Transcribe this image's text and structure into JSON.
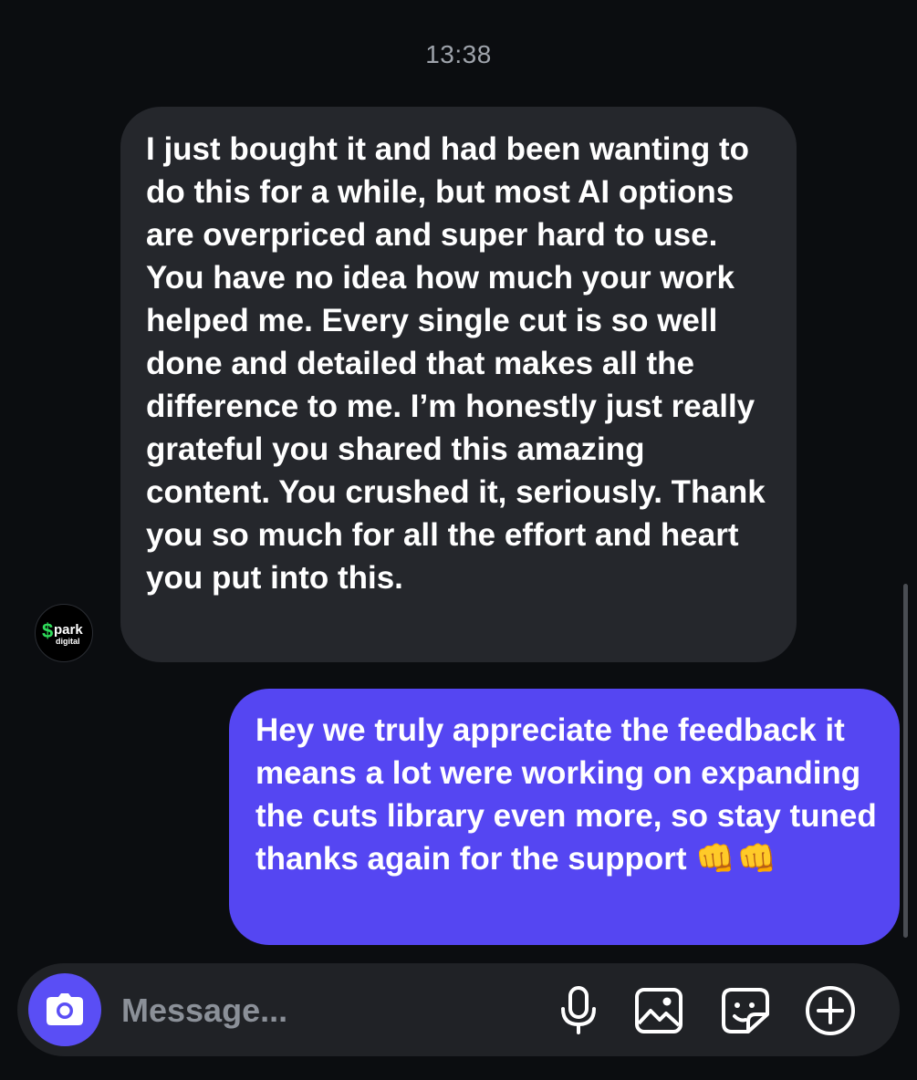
{
  "header": {
    "time": "13:38"
  },
  "contact": {
    "avatar_icon": "spark-digital-logo",
    "avatar_text_main": "park",
    "avatar_text_sub": "digital",
    "avatar_symbol": "$"
  },
  "messages": [
    {
      "direction": "incoming",
      "text": "I just bought it and had been wanting to do this for a while, but most AI options are overpriced and super hard to use. You have no idea how much your work helped me. Every single cut is so well done and detailed that makes all the difference to me. I’m honestly just really grateful you shared this amazing content. You crushed it, seriously. Thank you so much for all the effort and heart you put into this."
    },
    {
      "direction": "outgoing",
      "text": "Hey we truly appreciate the feedback it means a lot were working on expanding the cuts library even more, so stay tuned thanks again for the support",
      "emoji": "👊👊"
    }
  ],
  "composer": {
    "placeholder": "Message...",
    "value": "",
    "icons": [
      "camera-icon",
      "microphone-icon",
      "gallery-icon",
      "sticker-icon",
      "plus-circle-icon"
    ]
  },
  "colors": {
    "background": "#0b0d10",
    "incoming_bubble": "#25272c",
    "outgoing_bubble": "#5546f2",
    "camera_button": "#5a4ef5",
    "composer": "#202226",
    "timestamp": "#9ea3ab",
    "avatar_accent": "#2fdc5a"
  }
}
